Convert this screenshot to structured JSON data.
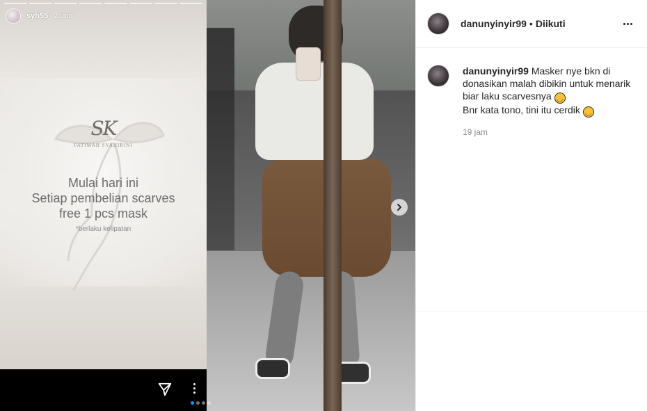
{
  "story": {
    "username": "syh55",
    "time": "2 jam",
    "logo_monogram": "SK",
    "brand_name": "FATIMAH SYAHIRINI",
    "lines": [
      "Mulai hari ini",
      "Setiap pembelian scarves",
      "free 1  pcs mask"
    ],
    "note": "*berlaku kelipatan",
    "icons": {
      "send": "send-icon",
      "more": "more-vertical-icon"
    }
  },
  "carousel": {
    "total_slides": 4,
    "active_index": 0,
    "next_icon": "chevron-right-icon"
  },
  "post": {
    "header": {
      "username": "danunyinyir99",
      "separator": "•",
      "follow_status": "Diikuti",
      "options_icon": "more-horizontal-icon"
    },
    "caption": {
      "username": "danunyinyir99",
      "line1": "Masker nye bkn di donasikan malah dibikin untuk menarik biar laku scarvesnya",
      "emoji1": "😆",
      "line2": "Bnr kata tono, tini itu cerdik",
      "emoji2": "😆",
      "time": "19 jam"
    }
  },
  "colors": {
    "text": "#262626",
    "muted": "#8e8e8e",
    "border": "#efefef",
    "accent": "#0095f6"
  }
}
